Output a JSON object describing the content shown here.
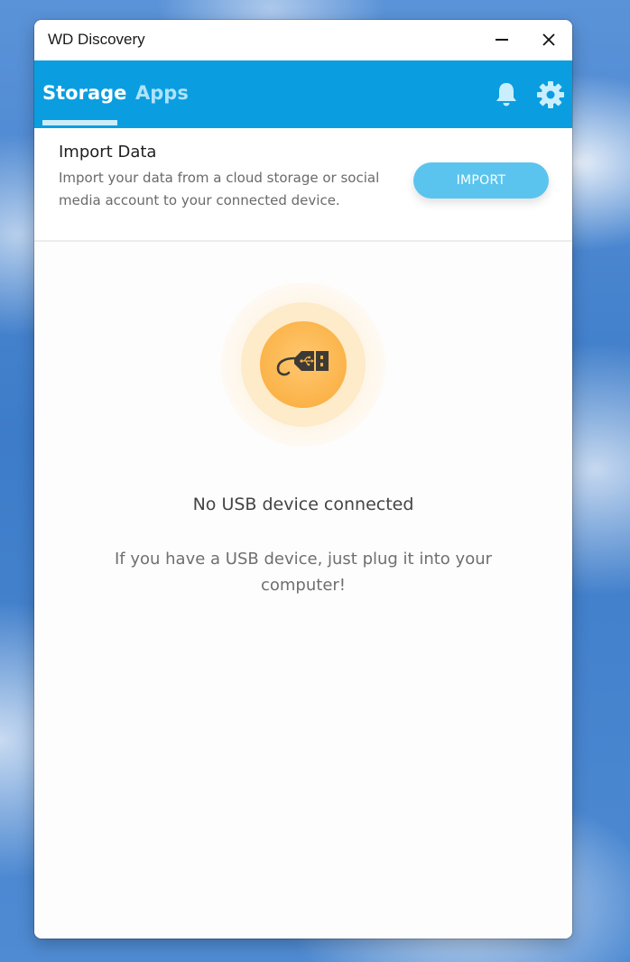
{
  "window": {
    "title": "WD Discovery",
    "controls": {
      "minimize_icon": "minimize-icon",
      "close_icon": "close-icon"
    }
  },
  "nav": {
    "tabs": [
      {
        "label": "Storage",
        "active": true
      },
      {
        "label": "Apps",
        "active": false
      }
    ],
    "icons": [
      "bell-icon",
      "gear-icon"
    ],
    "background_color": "#0a9ee0"
  },
  "import": {
    "title": "Import Data",
    "description": "Import your data from a cloud storage or social media account to your connected device.",
    "button_label": "IMPORT",
    "button_color": "#5bc4ee"
  },
  "empty_state": {
    "icon": "usb-icon",
    "accent_color": "#fbb349",
    "title": "No USB device connected",
    "message": "If you have a USB device, just plug it into your computer!"
  }
}
